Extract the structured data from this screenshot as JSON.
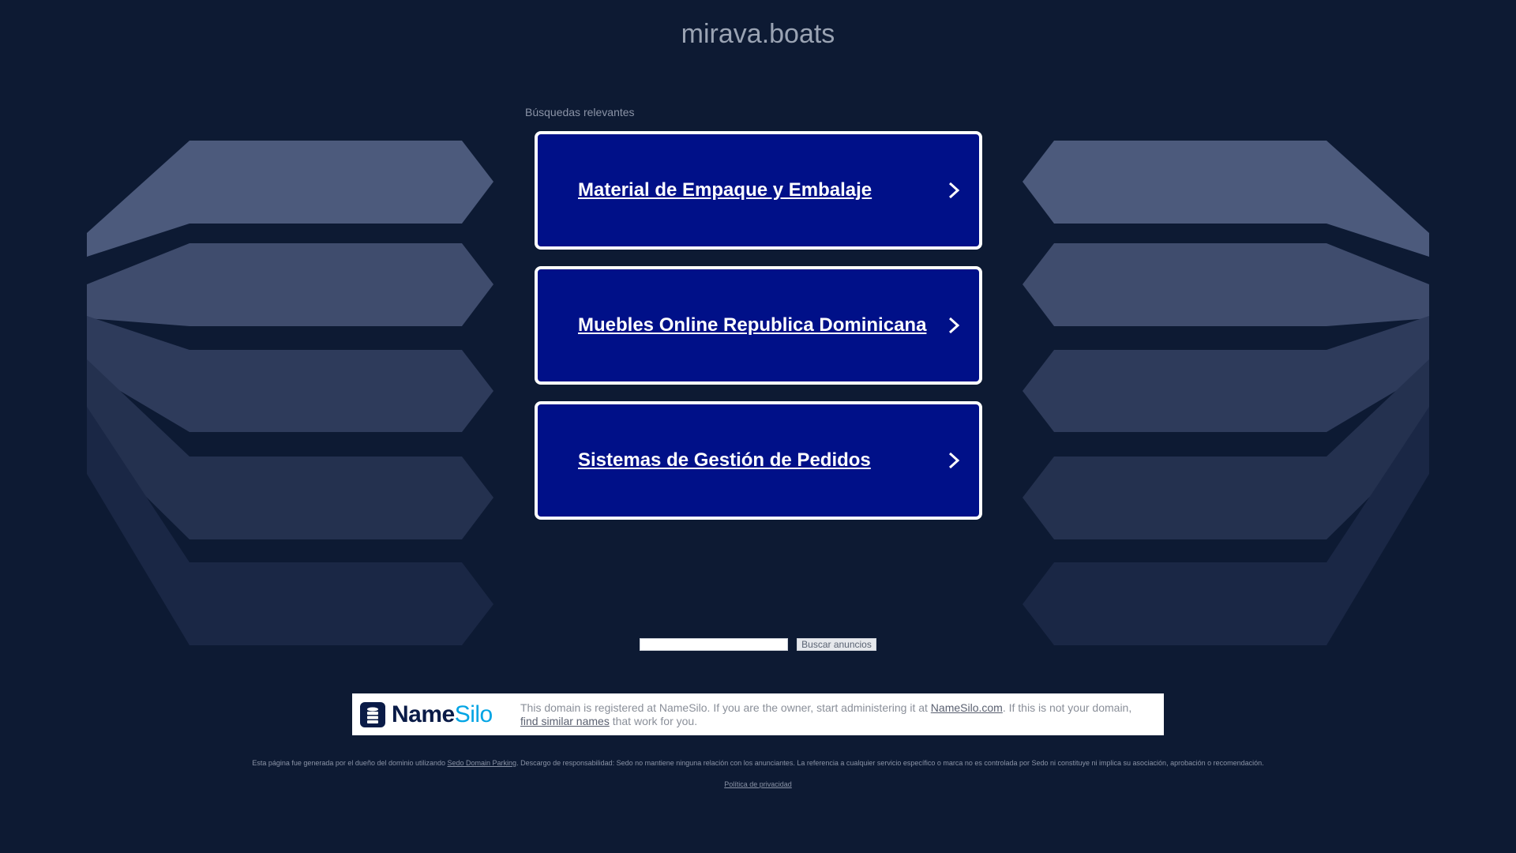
{
  "page": {
    "domain_title": "mirava.boats",
    "related_label": "Búsquedas relevantes"
  },
  "ads": [
    {
      "label": "Material de Empaque y Embalaje"
    },
    {
      "label": "Muebles Online Republica Dominicana"
    },
    {
      "label": "Sistemas de Gestión de Pedidos"
    }
  ],
  "search": {
    "placeholder": "",
    "button_label": "Buscar anuncios"
  },
  "registrar": {
    "logo_name": "NameSilo",
    "logo_prefix": "Name",
    "logo_suffix": "Silo",
    "text_1": "This domain is registered at NameSilo. If you are the owner, start administering it at ",
    "link_1": "NameSilo.com",
    "text_2": ". If this is not your domain, ",
    "link_2": "find similar names",
    "text_3": " that work for you."
  },
  "footer": {
    "disclaimer_1": "Esta página fue generada por el dueño del dominio utilizando ",
    "sedo_link": "Sedo Domain Parking",
    "disclaimer_2": ". Descargo de responsabilidad: Sedo no mantiene ninguna relación con los anunciantes. La referencia a cualquier servicio específico o marca no es controlada por Sedo ni constituye ni implica su asociación, aprobación o recomendación.",
    "privacy_link": "Política de privacidad"
  },
  "colors": {
    "background": "#0d1a33",
    "ad_card": "#001088",
    "ad_border": "#ffffff",
    "logo_dark": "#0a1b47",
    "logo_accent": "#00a4e4"
  }
}
